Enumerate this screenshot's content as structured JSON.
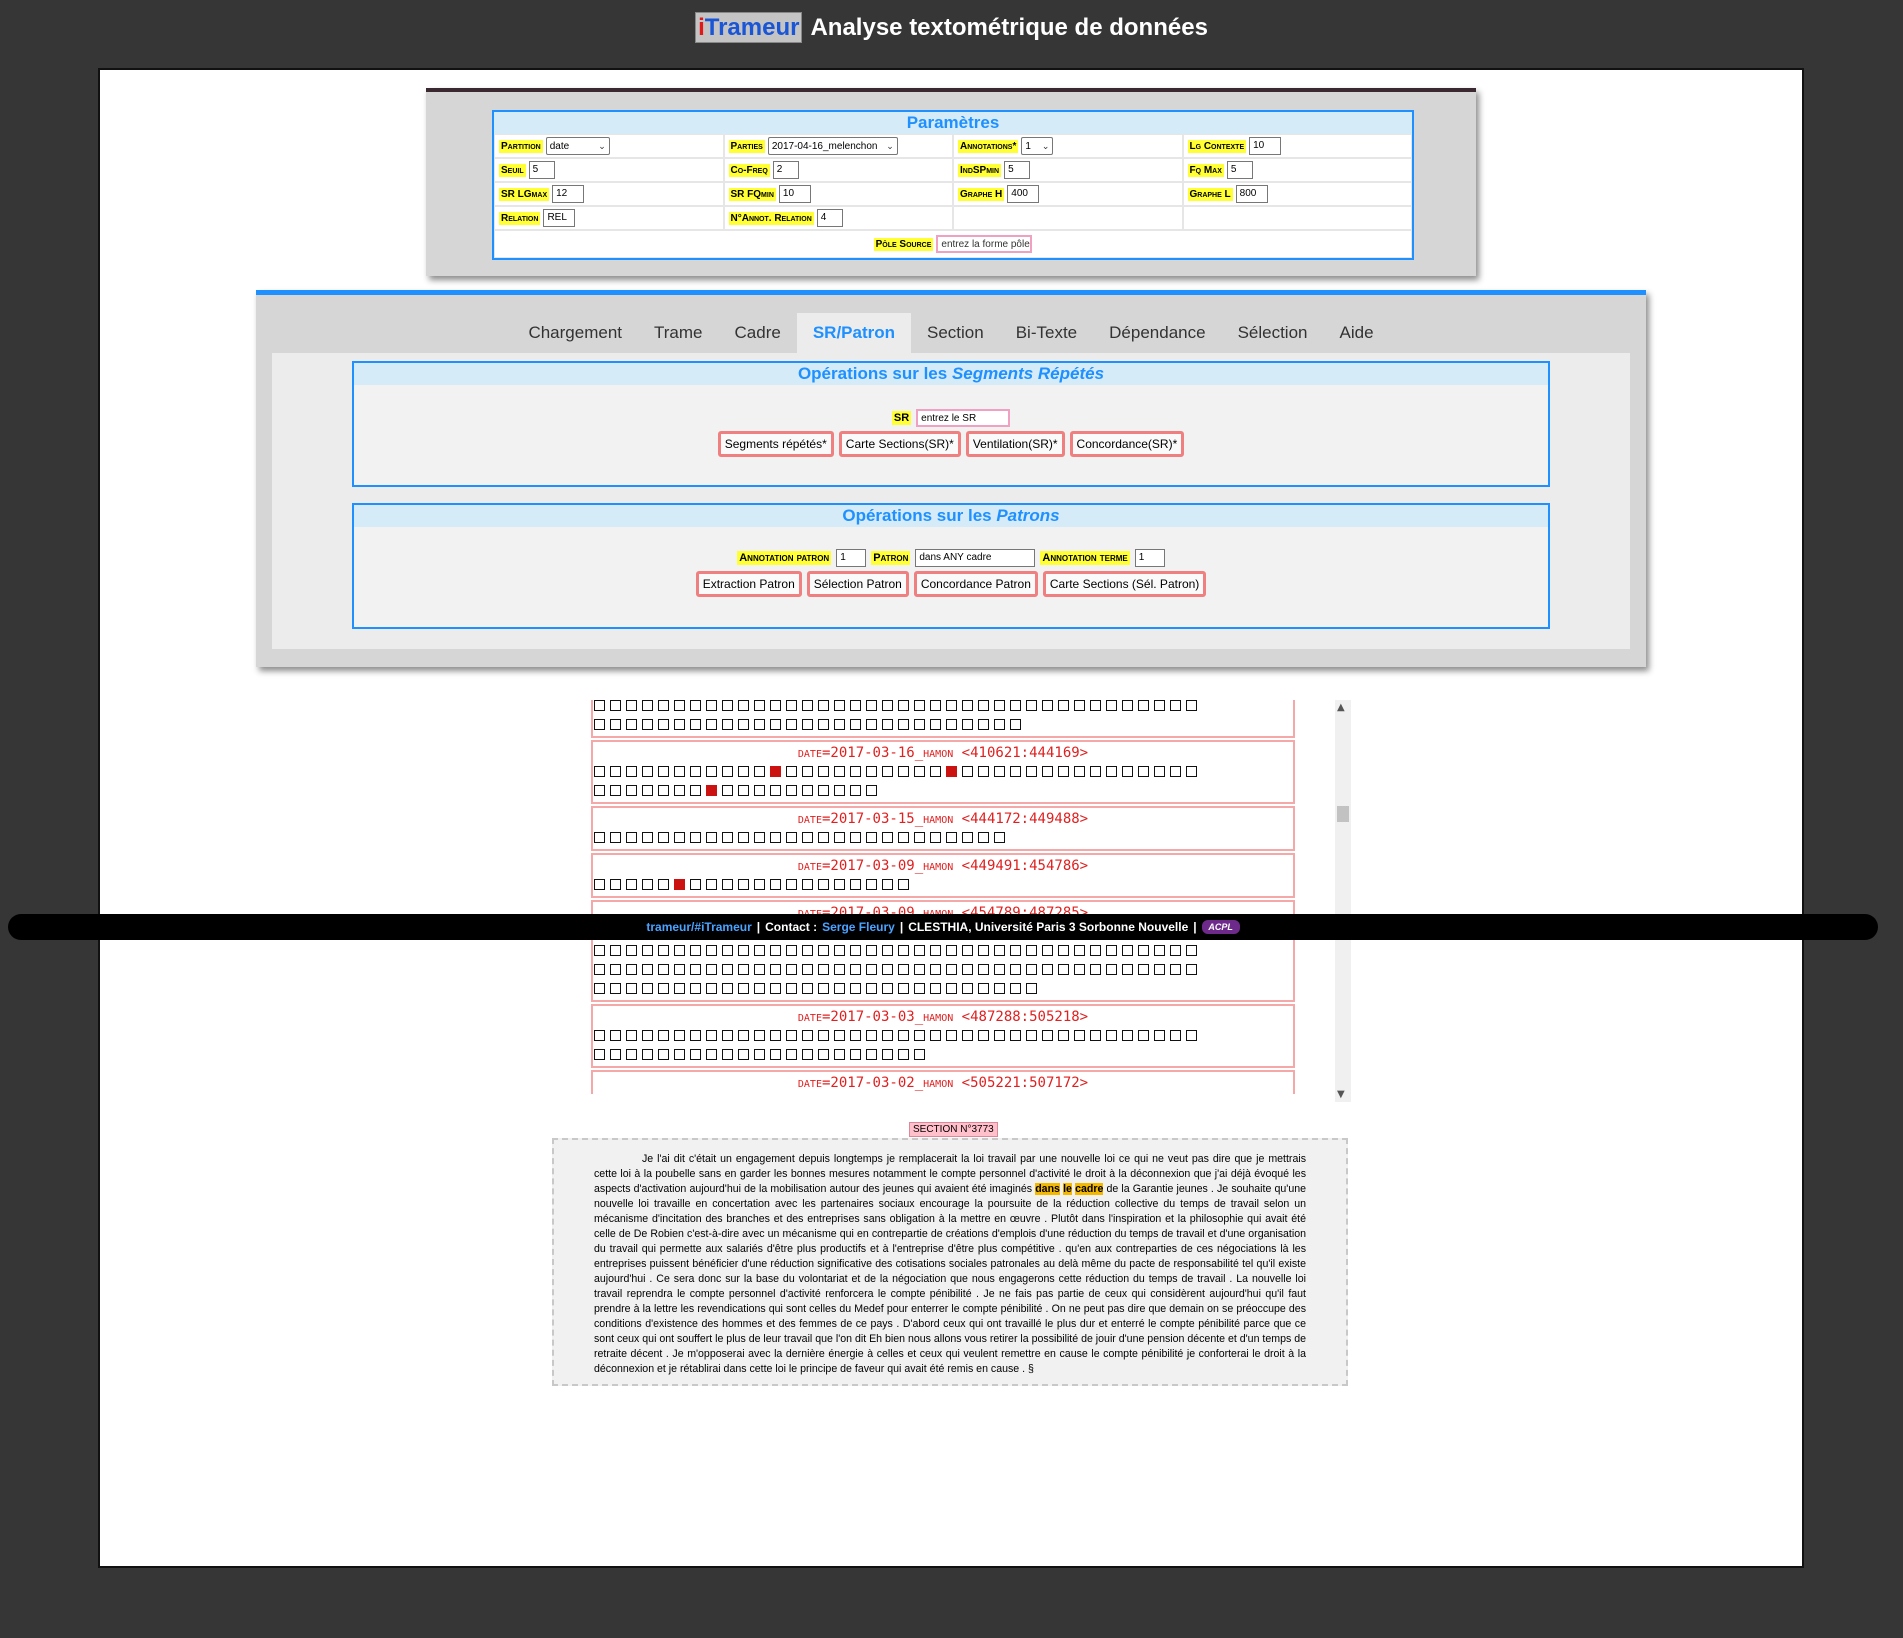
{
  "header": {
    "brand_i": "i",
    "brand_rest": "Trameur",
    "subtitle": "Analyse textométrique de données"
  },
  "params": {
    "title": "Paramètres",
    "partition": {
      "label": "Partition",
      "value": "date"
    },
    "parties": {
      "label": "Parties",
      "value": "2017-04-16_melenchon"
    },
    "annotations": {
      "label": "Annotations*",
      "value": "1"
    },
    "lg_contexte": {
      "label": "Lg Contexte",
      "value": "10"
    },
    "seuil": {
      "label": "Seuil",
      "value": "5"
    },
    "co_freq": {
      "label": "Co-Freq",
      "value": "2"
    },
    "indspmin": {
      "label": "IndSPmin",
      "value": "5"
    },
    "fq_max": {
      "label": "Fq Max",
      "value": "5"
    },
    "sr_lgmax": {
      "label": "SR LGmax",
      "value": "12"
    },
    "sr_fqmin": {
      "label": "SR FQmin",
      "value": "10"
    },
    "graphe_h": {
      "label": "Graphe H",
      "value": "400"
    },
    "graphe_l": {
      "label": "Graphe L",
      "value": "800"
    },
    "relation": {
      "label": "Relation",
      "value": "REL"
    },
    "annot_relation": {
      "label": "N°Annot. Relation",
      "value": "4"
    },
    "pole_source": {
      "label": "Pôle Source",
      "placeholder": "entrez la forme pôle"
    }
  },
  "tabs": [
    "Chargement",
    "Trame",
    "Cadre",
    "SR/Patron",
    "Section",
    "Bi-Texte",
    "Dépendance",
    "Sélection",
    "Aide"
  ],
  "active_tab": "SR/Patron",
  "sr_ops": {
    "title_prefix": "Opérations sur les ",
    "title_em": "Segments Répétés",
    "label": "SR",
    "placeholder": "entrez le SR",
    "buttons": [
      "Segments répétés*",
      "Carte Sections(SR)*",
      "Ventilation(SR)*",
      "Concordance(SR)*"
    ]
  },
  "patron_ops": {
    "title_prefix": "Opérations sur les ",
    "title_em": "Patrons",
    "annotation_patron_label": "Annotation patron",
    "annotation_patron_value": "1",
    "patron_label": "Patron",
    "patron_value": "dans ANY cadre",
    "annotation_terme_label": "Annotation terme",
    "annotation_terme_value": "1",
    "buttons": [
      "Extraction Patron",
      "Sélection Patron",
      "Concordance Patron",
      "Carte Sections (Sél. Patron)"
    ]
  },
  "map_sections": [
    {
      "head": "",
      "rows": [
        [
          38,
          []
        ],
        [
          27,
          []
        ]
      ]
    },
    {
      "head": {
        "pre": "date",
        "mid": "=2017-03-16_",
        "sc": "hamon",
        "range": " <410621:444169>"
      },
      "rows": [
        [
          38,
          [
            11,
            22
          ]
        ],
        [
          18,
          [
            7
          ]
        ]
      ]
    },
    {
      "head": {
        "pre": "date",
        "mid": "=2017-03-15_",
        "sc": "hamon",
        "range": " <444172:449488>"
      },
      "rows": [
        [
          26,
          []
        ]
      ]
    },
    {
      "head": {
        "pre": "date",
        "mid": "=2017-03-09_",
        "sc": "hamon",
        "range": " <449491:454786>"
      },
      "rows": [
        [
          20,
          [
            5
          ]
        ]
      ]
    },
    {
      "head": {
        "pre": "date",
        "mid": "=2017-03-09_",
        "sc": "hamon",
        "range": " <454789:487285>"
      },
      "rows": [
        [
          38,
          []
        ],
        [
          38,
          []
        ],
        [
          38,
          []
        ],
        [
          28,
          []
        ]
      ]
    },
    {
      "head": {
        "pre": "date",
        "mid": "=2017-03-03_",
        "sc": "hamon",
        "range": " <487288:505218>"
      },
      "rows": [
        [
          38,
          []
        ],
        [
          21,
          []
        ]
      ]
    },
    {
      "head": {
        "pre": "date",
        "mid": "=2017-03-02_",
        "sc": "hamon",
        "range": " <505221:507172>"
      },
      "rows": [
        [
          10,
          []
        ]
      ]
    }
  ],
  "footer": {
    "link": "trameur/#iTrameur",
    "contact_label": "Contact :",
    "contact_name": "Serge Fleury",
    "affiliation": "CLESTHIA, Université Paris 3 Sorbonne Nouvelle",
    "sep": "|",
    "logo_text": "ACPL"
  },
  "section": {
    "label": "SECTION N°3773",
    "text_before": "Je l'ai dit c'était un engagement depuis longtemps je remplacerait la loi travail par une nouvelle loi ce qui ne veut pas dire que je mettrais cette loi à la poubelle sans en garder les bonnes mesures notamment le compte personnel d'activité le droit à la déconnexion que j'ai déjà évoqué les aspects d'activation aujourd'hui de la mobilisation autour des jeunes qui avaient été imaginés ",
    "hl1": "dans",
    "hl2": "le",
    "hl3": "cadre",
    "text_after": " de la Garantie jeunes . Je souhaite qu'une nouvelle loi travaille en concertation avec les partenaires sociaux encourage la poursuite de la réduction collective du temps de travail selon un mécanisme d'incitation des branches et des entreprises sans obligation à la mettre en œuvre . Plutôt dans l'inspiration et la philosophie qui avait été celle de De Robien c'est-à-dire avec un mécanisme qui en contrepartie de créations d'emplois d'une réduction du temps de travail et d'une organisation du travail qui permette aux salariés d'être plus productifs et à l'entreprise d'être plus compétitive . qu'en aux contreparties de ces négociations là les entreprises puissent bénéficier d'une réduction significative des cotisations sociales patronales au delà même du pacte de responsabilité tel qu'il existe aujourd'hui . Ce sera donc sur la base du volontariat et de la négociation que nous engagerons cette réduction du temps de travail . La nouvelle loi travail reprendra le compte personnel d'activité renforcera le compte pénibilité . Je ne fais pas partie de ceux qui considèrent aujourd'hui qu'il faut prendre à la lettre les revendications qui sont celles du Medef pour enterrer le compte pénibilité . On ne peut pas dire que demain on se préoccupe des conditions d'existence des hommes et des femmes de ce pays . D'abord ceux qui ont travaillé le plus dur et enterré le compte pénibilité parce que ce sont ceux qui ont souffert le plus de leur travail que l'on dit Eh bien nous allons vous retirer la possibilité de jouir d'une pension décente et d'un temps de retraite décent . Je m'opposerai avec la dernière énergie à celles et ceux qui veulent remettre en cause le compte pénibilité je conforterai le droit à la déconnexion et je rétablirai dans cette loi le principe de faveur qui avait été remis en cause . §"
  },
  "colors": {
    "accent": "#1e90ff",
    "label_bg": "#ffff33",
    "button_border": "#f08080",
    "hit_square": "#cc1111",
    "highlight": "#f5b800"
  }
}
